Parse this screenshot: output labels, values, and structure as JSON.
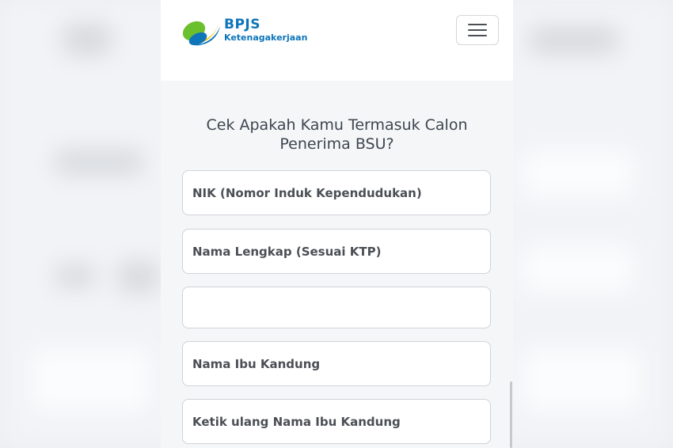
{
  "header": {
    "logo_title": "BPJS",
    "logo_subtitle": "Ketenagakerjaan",
    "menu_icon": "hamburger-menu-icon"
  },
  "form": {
    "title": "Cek Apakah Kamu Termasuk Calon Penerima BSU?",
    "fields": [
      {
        "placeholder": "NIK (Nomor Induk Kependudukan)"
      },
      {
        "placeholder": "Nama Lengkap (Sesuai KTP)"
      },
      {
        "placeholder": ""
      },
      {
        "placeholder": "Nama Ibu Kandung"
      },
      {
        "placeholder": "Ketik ulang Nama Ibu Kandung"
      }
    ]
  },
  "colors": {
    "brand_blue": "#0e75b8",
    "brand_green": "#6cbf2d",
    "brand_yellow": "#f2c300"
  }
}
